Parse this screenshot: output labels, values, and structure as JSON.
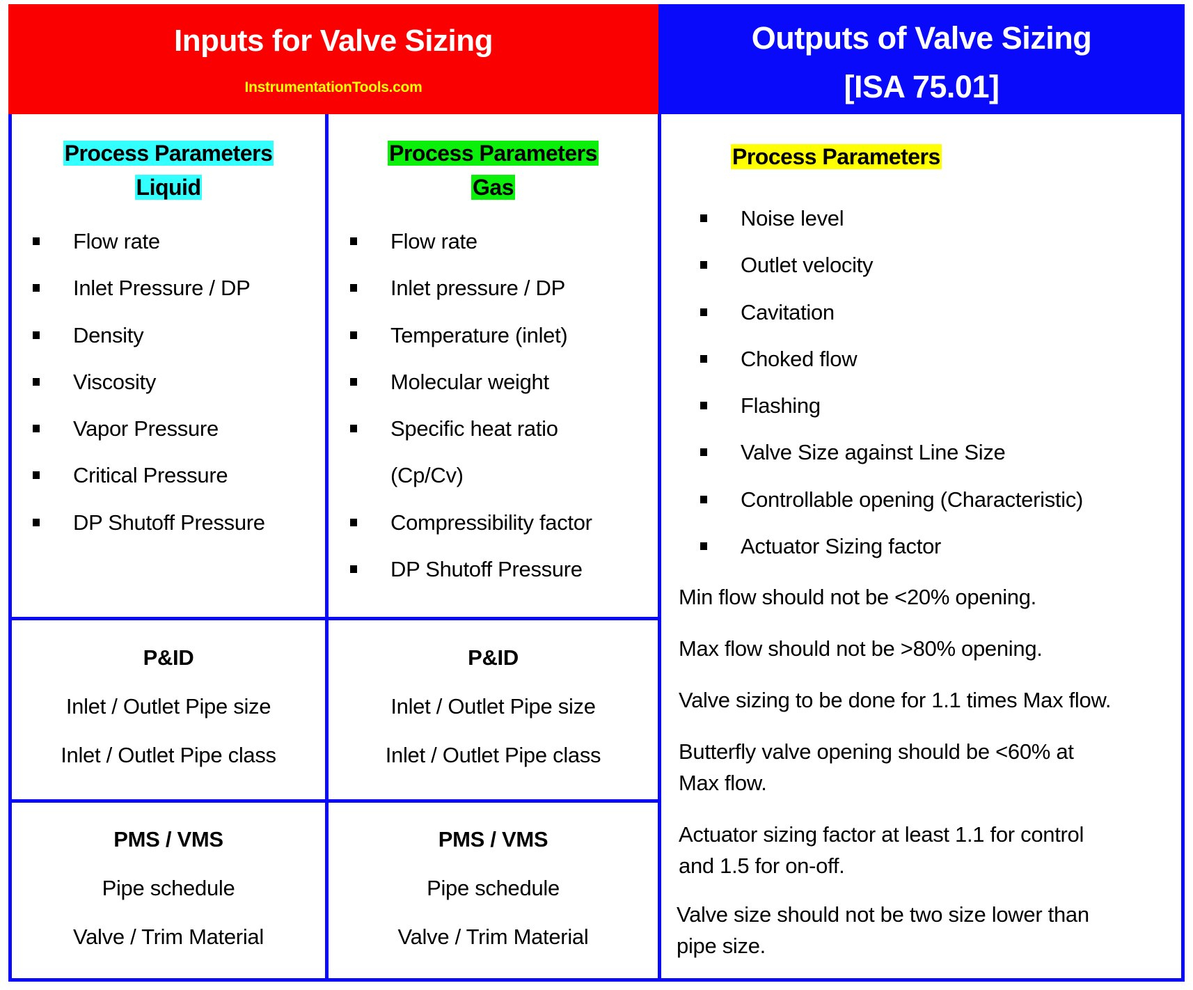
{
  "header": {
    "inputs_title": "Inputs for Valve Sizing",
    "watermark": "InstrumentationTools.com",
    "outputs_title_line1": "Outputs of Valve Sizing",
    "outputs_title_line2": "[ISA 75.01]"
  },
  "colors": {
    "inputs_header": "#fa0000",
    "outputs_header": "#0a0afa",
    "watermark": "#ffff00",
    "grid_lines": "#0a0afa",
    "liquid_highlight": "#33ffff",
    "gas_highlight": "#0af00a",
    "outputs_highlight": "#ffff00"
  },
  "liquid": {
    "title_line1": "Process Parameters",
    "title_line2": "Liquid",
    "items": [
      "Flow rate",
      "Inlet Pressure / DP",
      "Density",
      "Viscosity",
      "Vapor Pressure",
      "Critical Pressure",
      "DP Shutoff Pressure"
    ]
  },
  "gas": {
    "title_line1": "Process Parameters",
    "title_line2": "Gas",
    "items": [
      "Flow rate",
      "Inlet pressure / DP",
      "Temperature (inlet)",
      "Molecular weight",
      "Specific heat ratio",
      "(Cp/Cv)",
      "Compressibility factor",
      "DP Shutoff Pressure"
    ]
  },
  "pid": {
    "liquid": {
      "heading": "P&ID",
      "lines": [
        "Inlet / Outlet Pipe size",
        "Inlet / Outlet Pipe class"
      ]
    },
    "gas": {
      "heading": "P&ID",
      "lines": [
        "Inlet / Outlet Pipe size",
        "Inlet / Outlet Pipe class"
      ]
    }
  },
  "pms": {
    "liquid": {
      "heading": "PMS / VMS",
      "lines": [
        "Pipe schedule",
        "Valve / Trim Material"
      ]
    },
    "gas": {
      "heading": "PMS / VMS",
      "lines": [
        "Pipe schedule",
        "Valve / Trim Material"
      ]
    }
  },
  "outputs": {
    "title": "Process Parameters",
    "items": [
      "Noise level",
      "Outlet velocity",
      "Cavitation",
      "Choked flow",
      "Flashing",
      "Valve Size against Line Size",
      "Controllable opening (Characteristic)",
      "Actuator Sizing factor"
    ],
    "notes": [
      [
        "Min flow should not be <20% opening."
      ],
      [
        "Max flow should not be >80% opening."
      ],
      [
        "Valve sizing to be done for 1.1 times Max flow."
      ],
      [
        "Butterfly valve opening should be <60% at",
        "Max flow."
      ],
      [
        "Actuator sizing factor at least 1.1 for control",
        "and 1.5 for on-off."
      ],
      [
        "Valve size should not be two size lower than",
        "pipe size."
      ]
    ]
  }
}
